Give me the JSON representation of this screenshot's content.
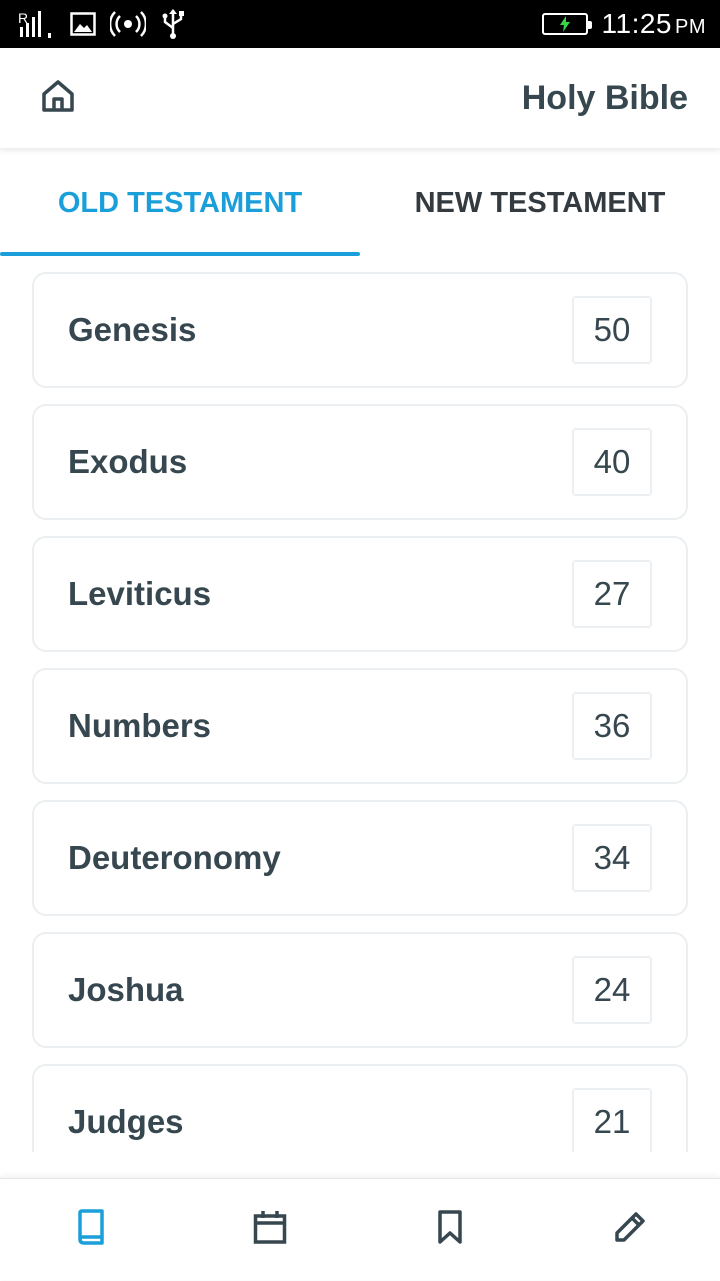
{
  "status_bar": {
    "time": "11:25",
    "ampm": "PM",
    "icons": [
      "signal-icon",
      "gallery-icon",
      "hotspot-icon",
      "usb-icon",
      "battery-charging-icon"
    ]
  },
  "header": {
    "title": "Holy Bible",
    "home_icon": "home-icon"
  },
  "tabs": [
    {
      "label": "OLD TESTAMENT",
      "active": true
    },
    {
      "label": "NEW TESTAMENT",
      "active": false
    }
  ],
  "books": [
    {
      "name": "Genesis",
      "chapters": "50"
    },
    {
      "name": "Exodus",
      "chapters": "40"
    },
    {
      "name": "Leviticus",
      "chapters": "27"
    },
    {
      "name": "Numbers",
      "chapters": "36"
    },
    {
      "name": "Deuteronomy",
      "chapters": "34"
    },
    {
      "name": "Joshua",
      "chapters": "24"
    },
    {
      "name": "Judges",
      "chapters": "21"
    }
  ],
  "bottom_nav": {
    "items": [
      {
        "icon": "book-icon",
        "active": true
      },
      {
        "icon": "calendar-icon",
        "active": false
      },
      {
        "icon": "bookmark-icon",
        "active": false
      },
      {
        "icon": "pencil-icon",
        "active": false
      }
    ]
  },
  "colors": {
    "accent": "#1a9fdb",
    "text": "#37474f",
    "border": "#eceff1"
  }
}
